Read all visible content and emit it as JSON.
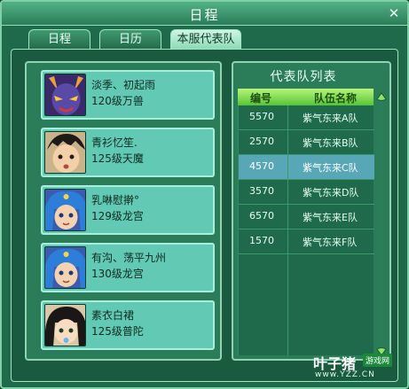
{
  "window": {
    "title": "日程",
    "close_glyph": "✕",
    "accent": "#53b285"
  },
  "tabs": [
    {
      "label": "日程",
      "active": false
    },
    {
      "label": "日历",
      "active": false
    },
    {
      "label": "本服代表队",
      "active": true
    }
  ],
  "members": [
    {
      "name": "淡季、初起雨",
      "level": "120级万兽",
      "avatar": "demon-avatar-icon"
    },
    {
      "name": "青衫忆笙.",
      "level": "125级天魔",
      "avatar": "boy-avatar-icon"
    },
    {
      "name": "乳啉慰擀°",
      "level": "129级龙宫",
      "avatar": "blue-hair-avatar-icon"
    },
    {
      "name": "有沟、荡平九州",
      "level": "130级龙宫",
      "avatar": "blue-hair-avatar-icon"
    },
    {
      "name": "素衣白裙",
      "level": "125级普陀",
      "avatar": "girl-avatar-icon"
    }
  ],
  "team_list": {
    "title": "代表队列表",
    "headers": {
      "id": "编号",
      "name": "队伍名称"
    },
    "rows": [
      {
        "id": "5570",
        "name": "紫气东来A队",
        "selected": false
      },
      {
        "id": "2570",
        "name": "紫气东来B队",
        "selected": false
      },
      {
        "id": "4570",
        "name": "紫气东来C队",
        "selected": true
      },
      {
        "id": "3570",
        "name": "紫气东来D队",
        "selected": false
      },
      {
        "id": "6570",
        "name": "紫气东来E队",
        "selected": false
      },
      {
        "id": "1570",
        "name": "紫气东来F队",
        "selected": false
      }
    ]
  },
  "watermark": {
    "main": "叶子猪",
    "badge": "游戏网",
    "url": "www.YZZ.CN"
  }
}
